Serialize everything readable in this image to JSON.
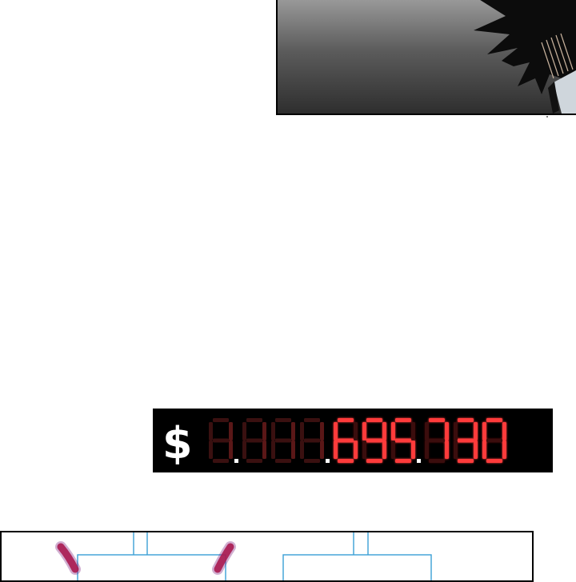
{
  "counter": {
    "currency_symbol": "$",
    "unlit_prefix": "1.111.",
    "lit_digits": "695,730",
    "digit_color": "#ff3b3b",
    "unlit_color": "#3a1010"
  }
}
